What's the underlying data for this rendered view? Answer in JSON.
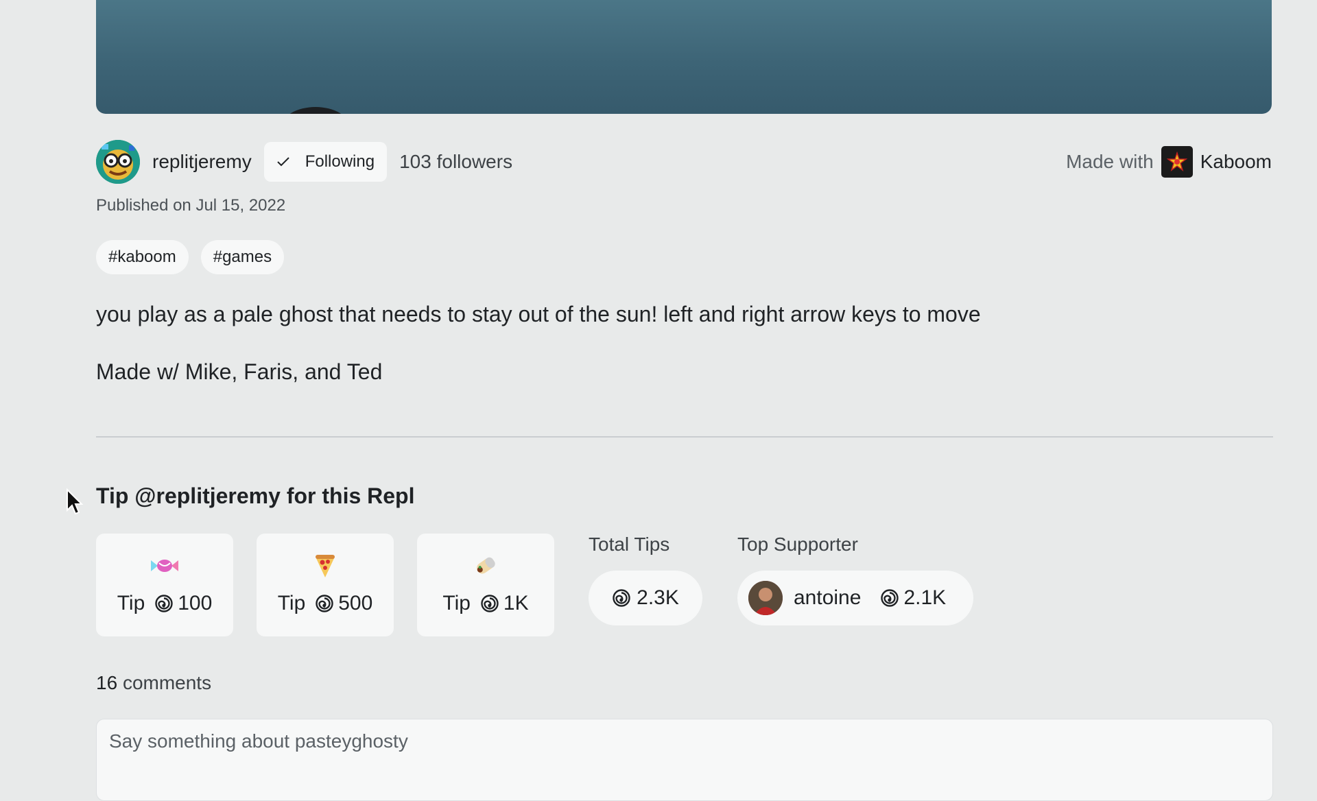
{
  "author": {
    "username": "replitjeremy",
    "follow_label": "Following",
    "followers_text": "103 followers",
    "made_with_label": "Made with",
    "made_with_tool": "Kaboom"
  },
  "published": "Published on Jul 15, 2022",
  "tags": [
    "#kaboom",
    "#games"
  ],
  "description": {
    "line1": "you play as a pale ghost that needs to stay out of the sun! left and right arrow keys to move",
    "line2": "Made w/ Mike, Faris, and Ted"
  },
  "tips": {
    "heading": "Tip @replitjeremy for this Repl",
    "options": [
      {
        "label": "Tip",
        "amount": "100",
        "icon": "candy-icon"
      },
      {
        "label": "Tip",
        "amount": "500",
        "icon": "pizza-icon"
      },
      {
        "label": "Tip",
        "amount": "1K",
        "icon": "burrito-icon"
      }
    ],
    "total_label": "Total Tips",
    "total_value": "2.3K",
    "top_supporter_label": "Top Supporter",
    "top_supporter_name": "antoine",
    "top_supporter_value": "2.1K"
  },
  "comments": {
    "count": "16",
    "label": "comments",
    "placeholder": "Say something about pasteyghosty"
  },
  "colors": {
    "background": "#e8eaea",
    "card": "#f7f8f8",
    "banner": "#446e80"
  }
}
